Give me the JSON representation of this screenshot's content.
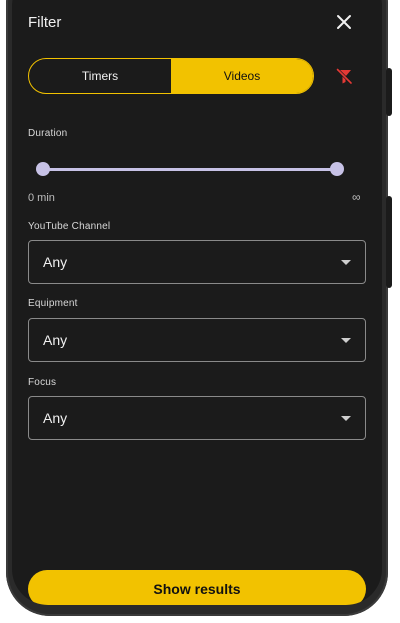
{
  "header": {
    "title": "Filter"
  },
  "toggle": {
    "timers_label": "Timers",
    "videos_label": "Videos",
    "selected": "Videos"
  },
  "duration": {
    "label": "Duration",
    "min_label": "0 min",
    "max_label": "∞"
  },
  "youtube_channel": {
    "label": "YouTube Channel",
    "value": "Any"
  },
  "equipment": {
    "label": "Equipment",
    "value": "Any"
  },
  "focus": {
    "label": "Focus",
    "value": "Any"
  },
  "show_results": {
    "label": "Show results"
  },
  "colors": {
    "accent": "#f2c200",
    "background": "#1b1b1b",
    "slider": "#c7c2e6",
    "clear_filter_icon": "#e53935"
  },
  "icons": {
    "close": "close-icon",
    "clear_filter": "filter-off-icon",
    "dropdown": "chevron-down-icon"
  }
}
